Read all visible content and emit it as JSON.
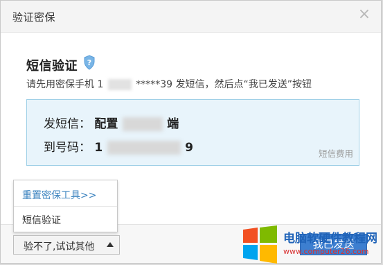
{
  "dialog": {
    "title": "验证密保",
    "close_icon": "×"
  },
  "main": {
    "heading": "短信验证",
    "subtitle_prefix": "请先用密保手机 1",
    "subtitle_suffix": "*****39 发短信，然后点“我已发送”按钮",
    "message_label": "发短信：",
    "message_value_start": "配置",
    "message_value_end": "端",
    "number_label": "到号码：",
    "number_value_start": "1",
    "number_value_end": "9",
    "fee_label": "短信费用"
  },
  "dropdown": {
    "reset_tool_link": "重置密保工具>>",
    "sms_item": "短信验证"
  },
  "footer": {
    "fallback_button": "验不了,试试其他",
    "primary_button": "我已发送"
  },
  "watermark": {
    "line1": "电脑软硬件教程网",
    "line2": "www.computer26.com"
  },
  "colors": {
    "accent": "#3d7fd0",
    "info_background": "#e8f4fb",
    "info_border": "#9ecfe7",
    "link": "#3b83bf"
  },
  "icons": {
    "close": "close-icon",
    "shield": "shield-question-icon",
    "caret": "caret-up-icon",
    "windows": "windows-logo-icon"
  }
}
